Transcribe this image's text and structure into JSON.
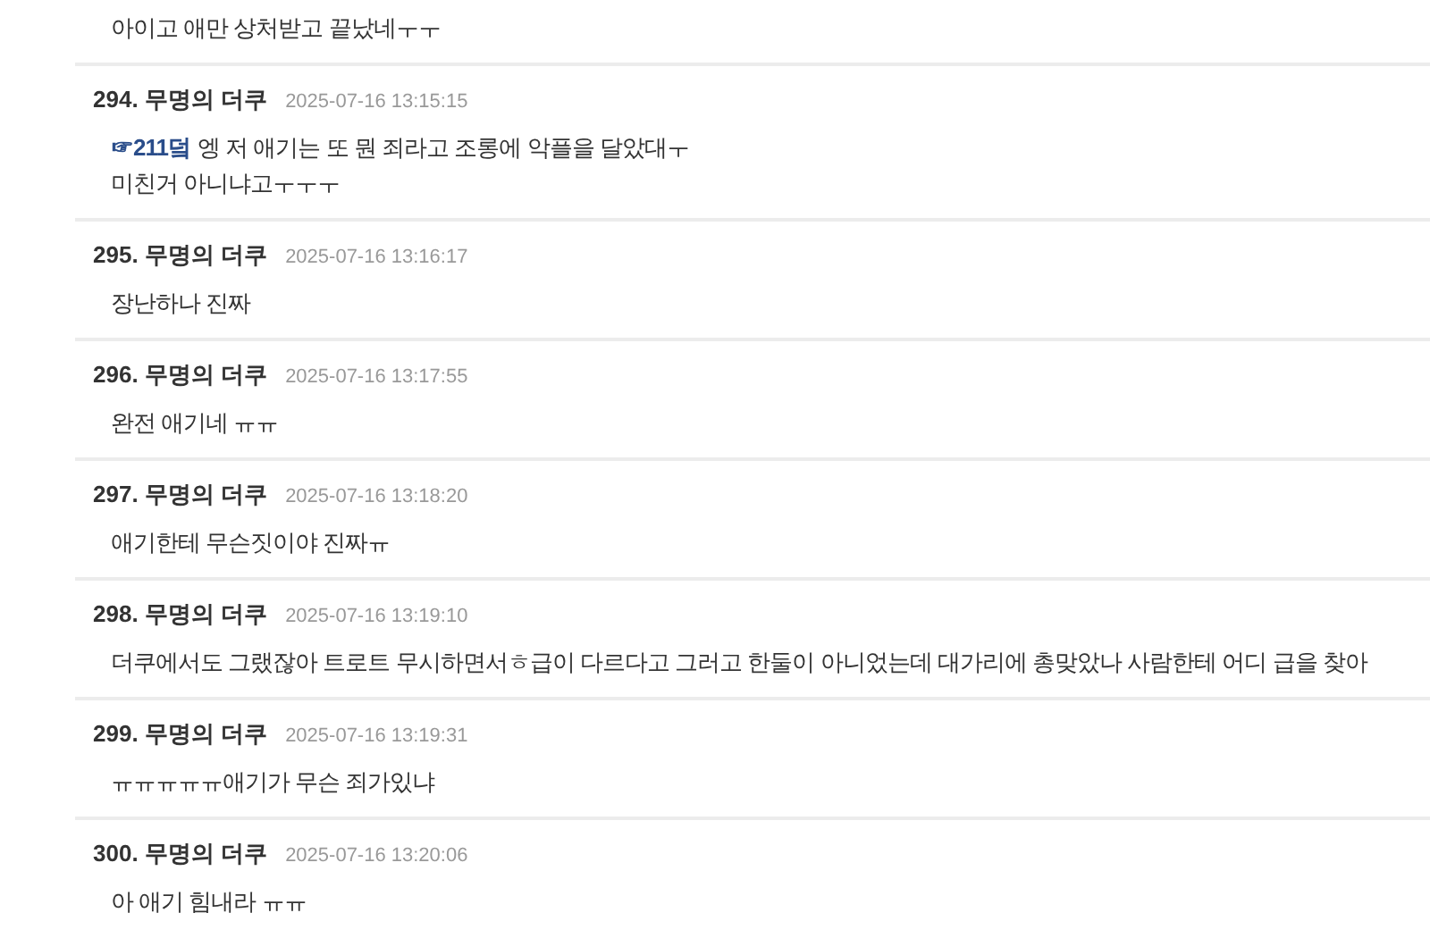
{
  "comments": [
    {
      "lines": [
        "아이고 애만 상처받고 끝났네ㅜㅜ"
      ]
    },
    {
      "number": "294.",
      "author": "무명의 더쿠",
      "time": "2025-07-16 13:15:15",
      "quote": "☞211덬",
      "lines": [
        "엥 저 애기는 또 뭔 죄라고 조롱에 악플을 달았대ㅜ",
        "미친거 아니냐고ㅜㅜㅜ"
      ]
    },
    {
      "number": "295.",
      "author": "무명의 더쿠",
      "time": "2025-07-16 13:16:17",
      "lines": [
        "장난하나 진짜"
      ]
    },
    {
      "number": "296.",
      "author": "무명의 더쿠",
      "time": "2025-07-16 13:17:55",
      "lines": [
        "완전 애기네 ㅠㅠ"
      ]
    },
    {
      "number": "297.",
      "author": "무명의 더쿠",
      "time": "2025-07-16 13:18:20",
      "lines": [
        "애기한테 무슨짓이야 진짜ㅠ"
      ]
    },
    {
      "number": "298.",
      "author": "무명의 더쿠",
      "time": "2025-07-16 13:19:10",
      "lines": [
        "더쿠에서도 그랬잖아 트로트 무시하면서ㅎ급이 다르다고 그러고 한둘이 아니었는데 대가리에 총맞았나 사람한테 어디 급을 찾아"
      ]
    },
    {
      "number": "299.",
      "author": "무명의 더쿠",
      "time": "2025-07-16 13:19:31",
      "lines": [
        "ㅠㅠㅠㅠㅠ애기가 무슨 죄가있냐"
      ]
    },
    {
      "number": "300.",
      "author": "무명의 더쿠",
      "time": "2025-07-16 13:20:06",
      "lines": [
        "아 애기 힘내라 ㅠㅠ"
      ]
    }
  ]
}
